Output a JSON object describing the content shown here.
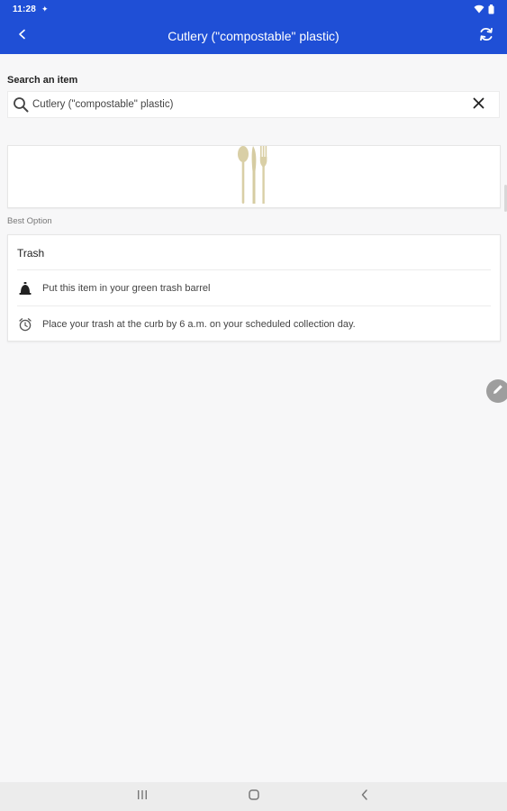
{
  "status_bar": {
    "time": "11:28",
    "dot": "✦",
    "icons": [
      "wifi-icon",
      "battery-icon"
    ]
  },
  "app_bar": {
    "title": "Cutlery (\"compostable\" plastic)",
    "icons": [
      "back-arrow-icon",
      "refresh-icon"
    ],
    "color": "#1f4fd6"
  },
  "search": {
    "label": "Search an item",
    "value": "Cutlery (\"compostable\" plastic)",
    "icons": [
      "search-icon",
      "clear-icon"
    ]
  },
  "item_image": {
    "icon": "cutlery-icon"
  },
  "best_option": {
    "label": "Best Option",
    "title": "Trash",
    "rows": [
      {
        "icon": "trash-barrel-icon",
        "text": "Put this item in your green trash barrel"
      },
      {
        "icon": "alarm-clock-icon",
        "text": "Place your trash at the curb by 6 a.m. on your scheduled collection day."
      }
    ]
  },
  "fab": {
    "icon": "pencil-icon"
  },
  "nav_bar": {
    "icons": [
      "recents-icon",
      "home-icon",
      "nav-back-icon"
    ]
  }
}
